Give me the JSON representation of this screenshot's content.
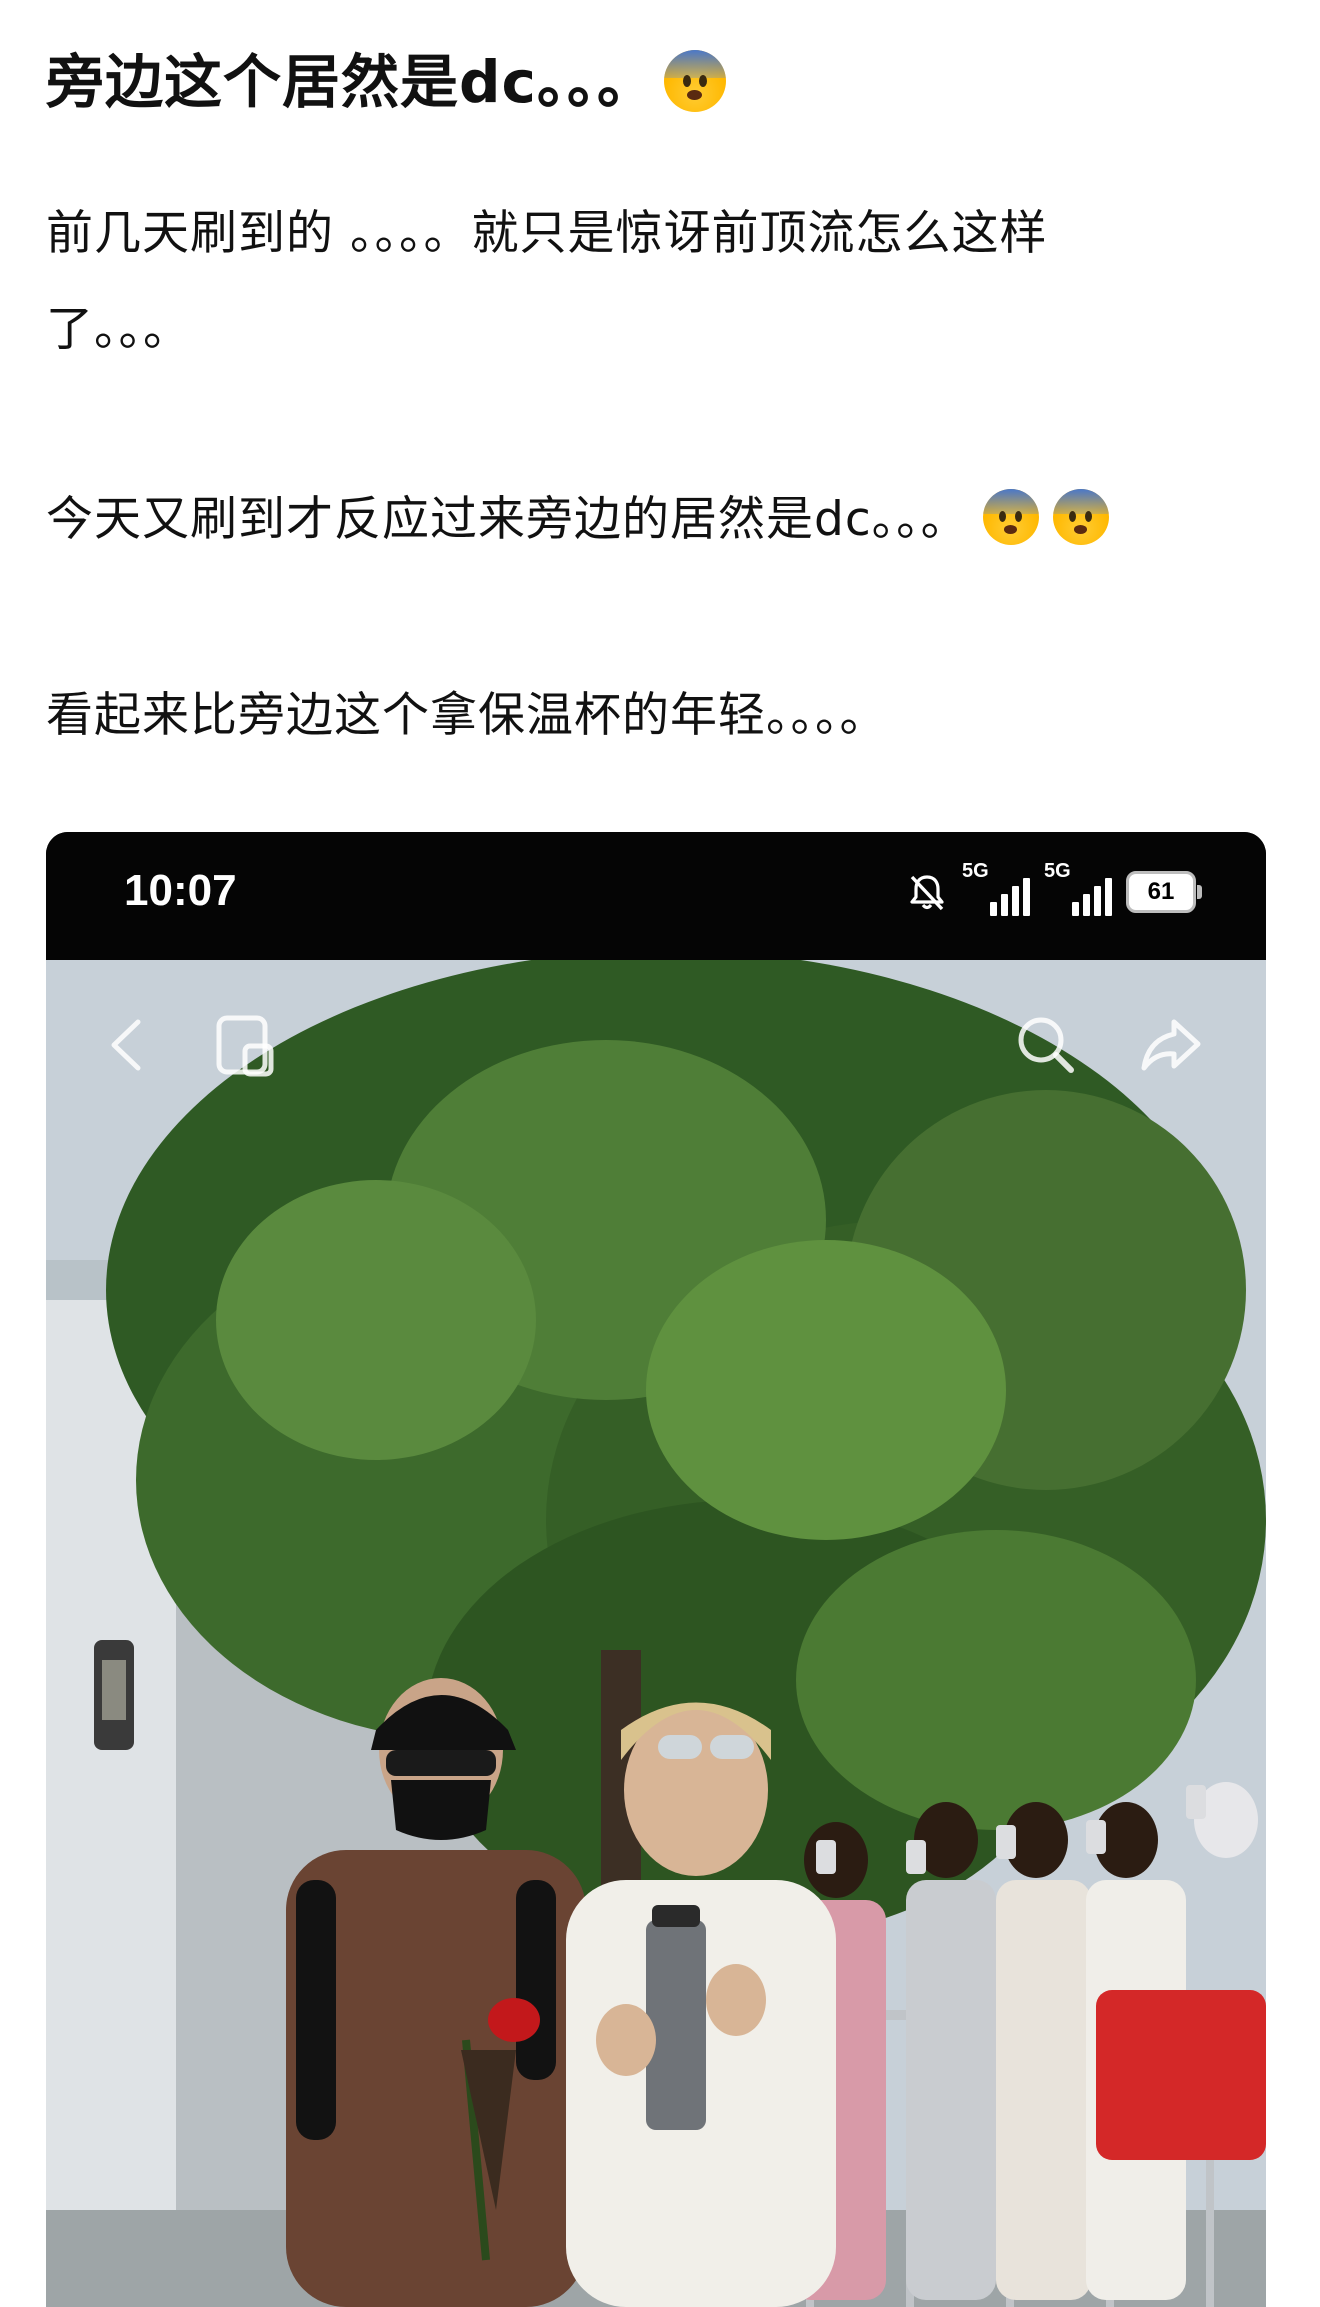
{
  "post": {
    "title": "旁边这个居然是dc。。。",
    "title_emoji": "anxious-face-with-sweat-icon",
    "paragraphs": [
      "前几天刷到的 。。。。就只是惊讶前顶流怎么这样",
      "了。。。",
      "今天又刷到才反应过来旁边的居然是dc。。。",
      "看起来比旁边这个拿保温杯的年轻。。。。"
    ],
    "paragraph3_emojis": [
      "anxious-face-with-sweat-icon",
      "anxious-face-with-sweat-icon"
    ]
  },
  "screenshot": {
    "status_bar": {
      "time": "10:07",
      "network_1": "5G",
      "network_2": "5G",
      "battery": "61",
      "mute_icon": "bell-muted-icon"
    },
    "overlay_icons": [
      "back-icon",
      "picture-in-picture-icon",
      "search-icon",
      "share-icon"
    ]
  },
  "colors": {
    "text": "#111111",
    "background": "#ffffff",
    "status_bar": "#050505"
  }
}
